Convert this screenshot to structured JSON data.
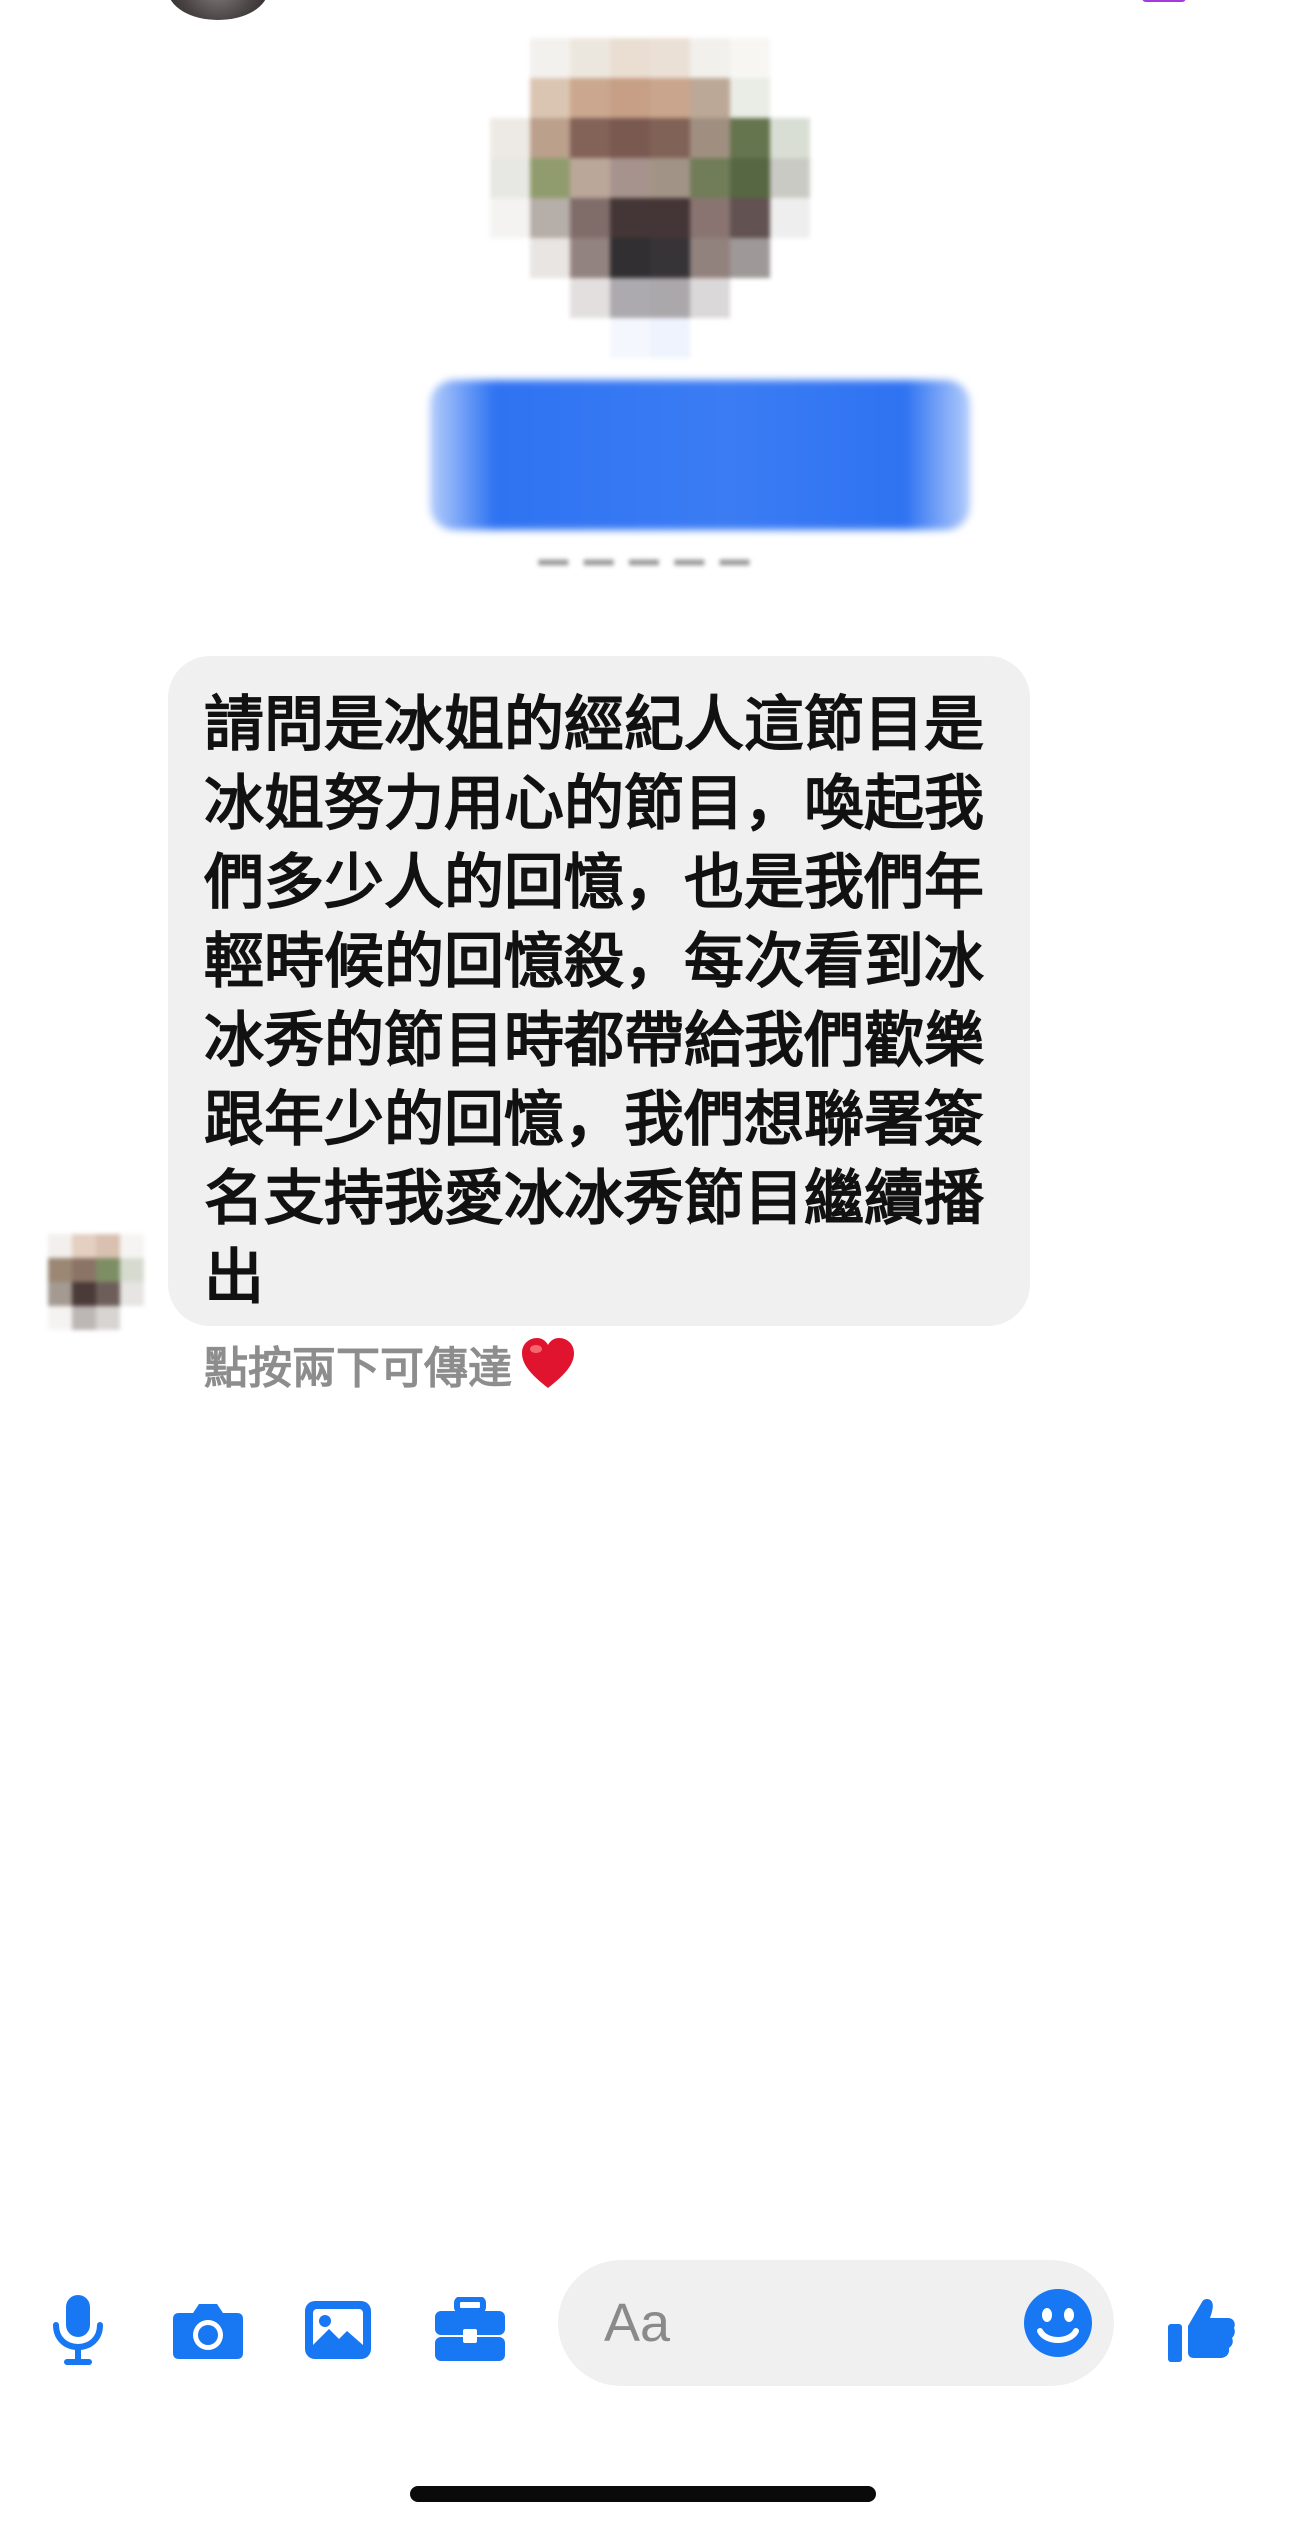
{
  "header": {
    "avatar_icon": "profile-avatar",
    "accent_color": "#a33be0"
  },
  "profile": {
    "avatar_icon": "pixelated-profile-photo",
    "name_blurred": true,
    "name_color": "#2f73f2"
  },
  "message": {
    "text": "請問是冰姐的經紀人這節目是冰姐努力用心的節目，喚起我們多少人的回憶，也是我們年輕時候的回憶殺，每次看到冰冰秀的節目時都帶給我們歡樂跟年少的回憶，我們想聯署簽名支持我愛冰冰秀節目繼續播出",
    "bubble_color": "#f0f0f0",
    "text_color": "#111111"
  },
  "hint": {
    "text": "點按兩下可傳達",
    "icon": "heart-icon",
    "heart_color": "#e0142f"
  },
  "composer": {
    "accent_color": "#1877f2",
    "icons": [
      "microphone-icon",
      "camera-icon",
      "image-icon",
      "briefcase-icon",
      "emoji-icon",
      "thumbs-up-icon"
    ],
    "placeholder": "Aa"
  }
}
